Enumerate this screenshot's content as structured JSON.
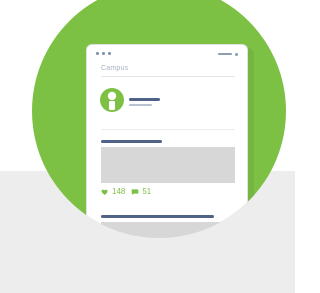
{
  "app": {
    "title": "Campus"
  },
  "post": {
    "likes": "148",
    "comments": "51"
  },
  "icons": {
    "avatar": "user-avatar-icon",
    "likes": "heart-icon",
    "comments": "comment-icon"
  },
  "colors": {
    "accent_green": "#7cc044",
    "text_navy": "#4f6287",
    "placeholder_gray": "#d7d7d7",
    "band_gray": "#ededed"
  }
}
